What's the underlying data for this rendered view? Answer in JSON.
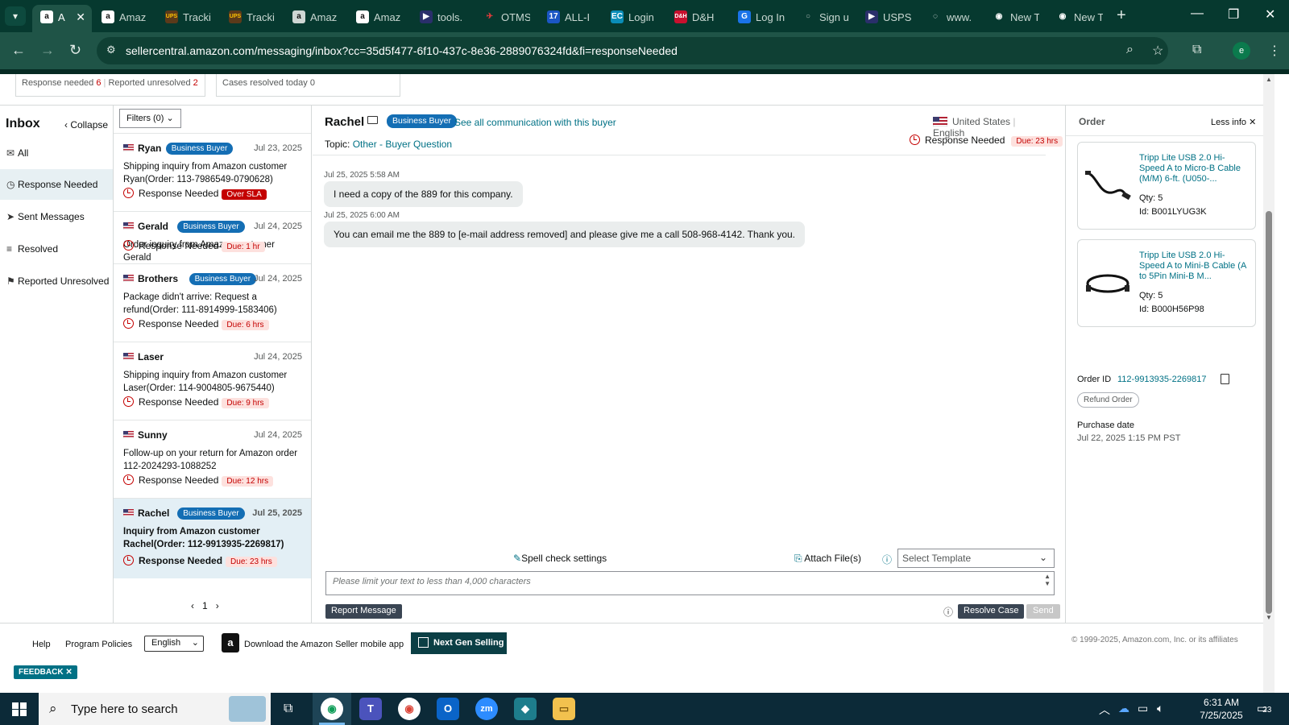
{
  "browser": {
    "tabs": [
      {
        "label": "A",
        "favicon": "a",
        "favicon_bg": "#ffffff",
        "favicon_fg": "#111111",
        "active": true
      },
      {
        "label": "Amaz",
        "favicon": "a",
        "favicon_bg": "#ffffff",
        "favicon_fg": "#111111"
      },
      {
        "label": "Tracki",
        "favicon": "UPS",
        "favicon_bg": "#5b3a1a",
        "favicon_fg": "#ffc400"
      },
      {
        "label": "Tracki",
        "favicon": "UPS",
        "favicon_bg": "#5b3a1a",
        "favicon_fg": "#ffc400"
      },
      {
        "label": "Amaz",
        "favicon": "a",
        "favicon_bg": "#cfd7d4",
        "favicon_fg": "#111111"
      },
      {
        "label": "Amaz",
        "favicon": "a",
        "favicon_bg": "#ffffff",
        "favicon_fg": "#111111"
      },
      {
        "label": "tools.",
        "favicon": "▶",
        "favicon_bg": "#2a2f6b",
        "favicon_fg": "#ffffff"
      },
      {
        "label": "OTMS",
        "favicon": "✈",
        "favicon_bg": "#06392f",
        "favicon_fg": "#e23b3b"
      },
      {
        "label": "ALL-I",
        "favicon": "17",
        "favicon_bg": "#1b56c4",
        "favicon_fg": "#ffffff"
      },
      {
        "label": "Login",
        "favicon": "EC",
        "favicon_bg": "#0a8db8",
        "favicon_fg": "#ffffff"
      },
      {
        "label": "D&H",
        "favicon": "D&H",
        "favicon_bg": "#c8102e",
        "favicon_fg": "#ffffff"
      },
      {
        "label": "Log In",
        "favicon": "G",
        "favicon_bg": "#1a73e8",
        "favicon_fg": "#ffffff"
      },
      {
        "label": "Sign u",
        "favicon": "○",
        "favicon_bg": "#06392f",
        "favicon_fg": "#aab9b4"
      },
      {
        "label": "USPS",
        "favicon": "▶",
        "favicon_bg": "#2a2f6b",
        "favicon_fg": "#ffffff"
      },
      {
        "label": "www.",
        "favicon": "◌",
        "favicon_bg": "#06392f",
        "favicon_fg": "#ffffff"
      },
      {
        "label": "New T",
        "favicon": "◉",
        "favicon_bg": "#06392f",
        "favicon_fg": "#ffffff"
      },
      {
        "label": "New T",
        "favicon": "◉",
        "favicon_bg": "#06392f",
        "favicon_fg": "#ffffff"
      }
    ],
    "url": "sellercentral.amazon.com/messaging/inbox?cc=35d5f477-6f10-437c-8e36-2889076324fd&fi=responseNeeded",
    "profile_initial": "e"
  },
  "stats": {
    "response_needed_label": "Response needed",
    "response_needed_count": "6",
    "reported_unresolved_label": "Reported unresolved",
    "reported_unresolved_count": "2",
    "cases_resolved_label": "Cases resolved today",
    "cases_resolved_count": "0"
  },
  "sidebar": {
    "title": "Inbox",
    "collapse_label": "Collapse",
    "items": [
      {
        "label": "All",
        "icon": "mail-icon"
      },
      {
        "label": "Response Needed",
        "icon": "clock-icon",
        "selected": true
      },
      {
        "label": "Sent Messages",
        "icon": "send-icon"
      },
      {
        "label": "Resolved",
        "icon": "resolved-icon"
      },
      {
        "label": "Reported Unresolved",
        "icon": "person-flag-icon"
      }
    ]
  },
  "conversation_list": {
    "filters_label": "Filters (0)",
    "items": [
      {
        "name": "Ryan",
        "badge": "Business Buyer",
        "date": "Jul 23, 2025",
        "subject": "Shipping inquiry from Amazon customer Ryan(Order: 113-7986549-0790628)",
        "status": "Response Needed",
        "due": "Over SLA",
        "overdue": true
      },
      {
        "name": "Gerald",
        "badge": "Business Buyer",
        "date": "Jul 24, 2025",
        "subject": "Order inquiry from Amazon customer Gerald",
        "status": "Response Needed",
        "due": "Due: 1 hr"
      },
      {
        "name": "Brothers",
        "badge": "Business Buyer",
        "date": "Jul 24, 2025",
        "subject": "Package didn't arrive: Request a refund(Order: 111-8914999-1583406)",
        "status": "Response Needed",
        "due": "Due: 6 hrs"
      },
      {
        "name": "Laser",
        "badge": "",
        "date": "Jul 24, 2025",
        "subject": "Shipping inquiry from Amazon customer Laser(Order: 114-9004805-9675440)",
        "status": "Response Needed",
        "due": "Due: 9 hrs"
      },
      {
        "name": "Sunny",
        "badge": "",
        "date": "Jul 24, 2025",
        "subject": "Follow-up on your return for Amazon order 112-2024293-1088252",
        "status": "Response Needed",
        "due": "Due: 12 hrs"
      },
      {
        "name": "Rachel",
        "badge": "Business Buyer",
        "date": "Jul 25, 2025",
        "subject": "Inquiry from Amazon customer Rachel(Order: 112-9913935-2269817)",
        "status": "Response Needed",
        "due": "Due: 23 hrs",
        "selected": true
      }
    ],
    "page": "1"
  },
  "conversation": {
    "buyer_name": "Rachel",
    "badge": "Business Buyer",
    "see_all": "See all communication with this buyer",
    "country": "United States",
    "language": "English",
    "topic_label": "Topic:",
    "topic_value": "Other - Buyer Question",
    "status": "Response Needed",
    "due": "Due: 23 hrs",
    "messages": [
      {
        "time": "Jul 25, 2025 5:58 AM",
        "text": "I need a copy of the 889 for this company."
      },
      {
        "time": "Jul 25, 2025 6:00 AM",
        "text": "You can email me the 889 to [e-mail address removed] and please give me a call 508-968-4142.  Thank you."
      }
    ],
    "spell_check": "Spell check settings",
    "attach": "Attach File(s)",
    "template_placeholder": "Select Template",
    "textarea_placeholder": "Please limit your text to less than 4,000 characters",
    "report_button": "Report Message",
    "resolve_button": "Resolve Case",
    "send_button": "Send"
  },
  "order": {
    "title": "Order",
    "less_info": "Less info",
    "products": [
      {
        "title": "Tripp Lite USB 2.0 Hi-Speed A to Micro-B Cable (M/M) 6-ft. (U050-...",
        "qty_label": "Qty:",
        "qty": "5",
        "id_label": "Id:",
        "id": "B001LYUG3K"
      },
      {
        "title": "Tripp Lite USB 2.0 Hi-Speed A to Mini-B Cable (A to 5Pin Mini-B M...",
        "qty_label": "Qty:",
        "qty": "5",
        "id_label": "Id:",
        "id": "B000H56P98"
      }
    ],
    "order_id_label": "Order ID",
    "order_id": "112-9913935-2269817",
    "refund_label": "Refund Order",
    "purchase_date_label": "Purchase date",
    "purchase_date": "Jul 22, 2025 1:15 PM PST"
  },
  "footer": {
    "help": "Help",
    "program_policies": "Program Policies",
    "language": "English",
    "download_app": "Download the Amazon Seller mobile app",
    "next_gen": "Next Gen Selling",
    "copyright": "© 1999-2025, Amazon.com, Inc. or its affiliates",
    "feedback": "FEEDBACK"
  },
  "taskbar": {
    "search_placeholder": "Type here to search",
    "time": "6:31 AM",
    "date": "7/25/2025",
    "notifications": "23"
  },
  "colors": {
    "chrome_dark": "#06392f",
    "chrome_toolbar": "#1f5447",
    "link": "#007185",
    "badge_blue": "#146eb4",
    "alert_red": "#c40000"
  }
}
